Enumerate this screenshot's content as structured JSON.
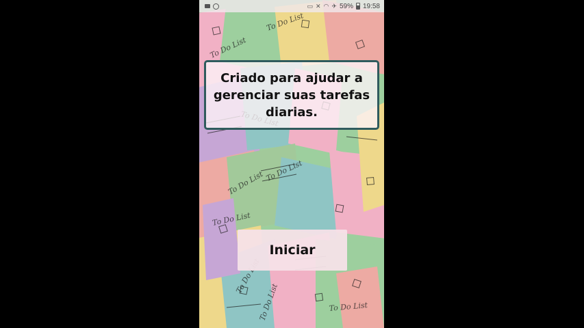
{
  "statusbar": {
    "left_icons": [
      "screen-record-icon",
      "circle-check-icon"
    ],
    "right_icons": [
      "cast-icon",
      "mute-icon",
      "wifi-icon",
      "airplane-icon"
    ],
    "battery": "59%",
    "time": "19:58"
  },
  "main": {
    "message": "Criado para ajudar a gerenciar suas tarefas diarias.",
    "start_button_label": "Iniciar"
  },
  "background": {
    "description": "collage of pastel To-Do list notes",
    "note_text": "To Do List",
    "colors": [
      "#9dcf9e",
      "#f2a9a4",
      "#f3d98a",
      "#c9a4d8",
      "#8fc5c7",
      "#f6b0c8",
      "#a3c99a"
    ]
  }
}
